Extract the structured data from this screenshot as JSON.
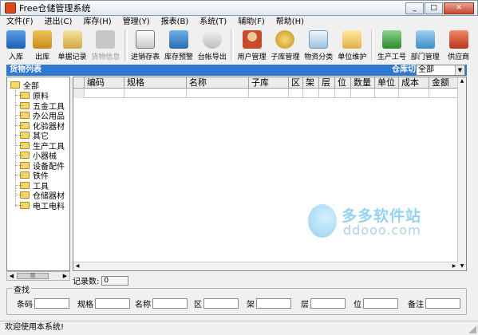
{
  "window": {
    "title": "Free仓储管理系统",
    "min": "_",
    "max": "□",
    "close": "✕"
  },
  "menu": [
    "文件(F)",
    "进出(C)",
    "库存(H)",
    "管理(Y)",
    "报表(B)",
    "系统(T)",
    "辅助(F)",
    "帮助(H)"
  ],
  "toolbar": {
    "in": "入库",
    "out": "出库",
    "single": "单据记录",
    "goods": "货物信息",
    "sales": "进销存表",
    "warn": "库存预警",
    "export": "台帐导出",
    "users": "用户管理",
    "sublib": "子库管理",
    "category": "物资分类",
    "unit": "单位维护",
    "worker": "生产工号",
    "dept": "部门管理",
    "supplier": "供应商"
  },
  "goods_list_label": "货物列表",
  "warehouse_switch": {
    "label": "仓库切换",
    "value": "全部"
  },
  "tree": {
    "root": "全部",
    "items": [
      "原料",
      "五金工具",
      "办公用品",
      "化验器材",
      "其它",
      "生产工具",
      "小器械",
      "设备配件",
      "铁件",
      "工具",
      "仓储器材",
      "电工电料"
    ]
  },
  "table": {
    "columns": [
      "编码",
      "规格",
      "名称",
      "子库",
      "区",
      "架",
      "层",
      "位",
      "数量",
      "单位",
      "成本",
      "金额",
      "备"
    ]
  },
  "record_count": {
    "label": "记录数:",
    "value": "0"
  },
  "search": {
    "legend": "查找",
    "fields": [
      "条码",
      "规格",
      "名称",
      "区",
      "架",
      "层",
      "位",
      "备注"
    ]
  },
  "status": "欢迎使用本系统!",
  "watermark": {
    "cn": "多多软件站",
    "url": "ddooo.com"
  }
}
